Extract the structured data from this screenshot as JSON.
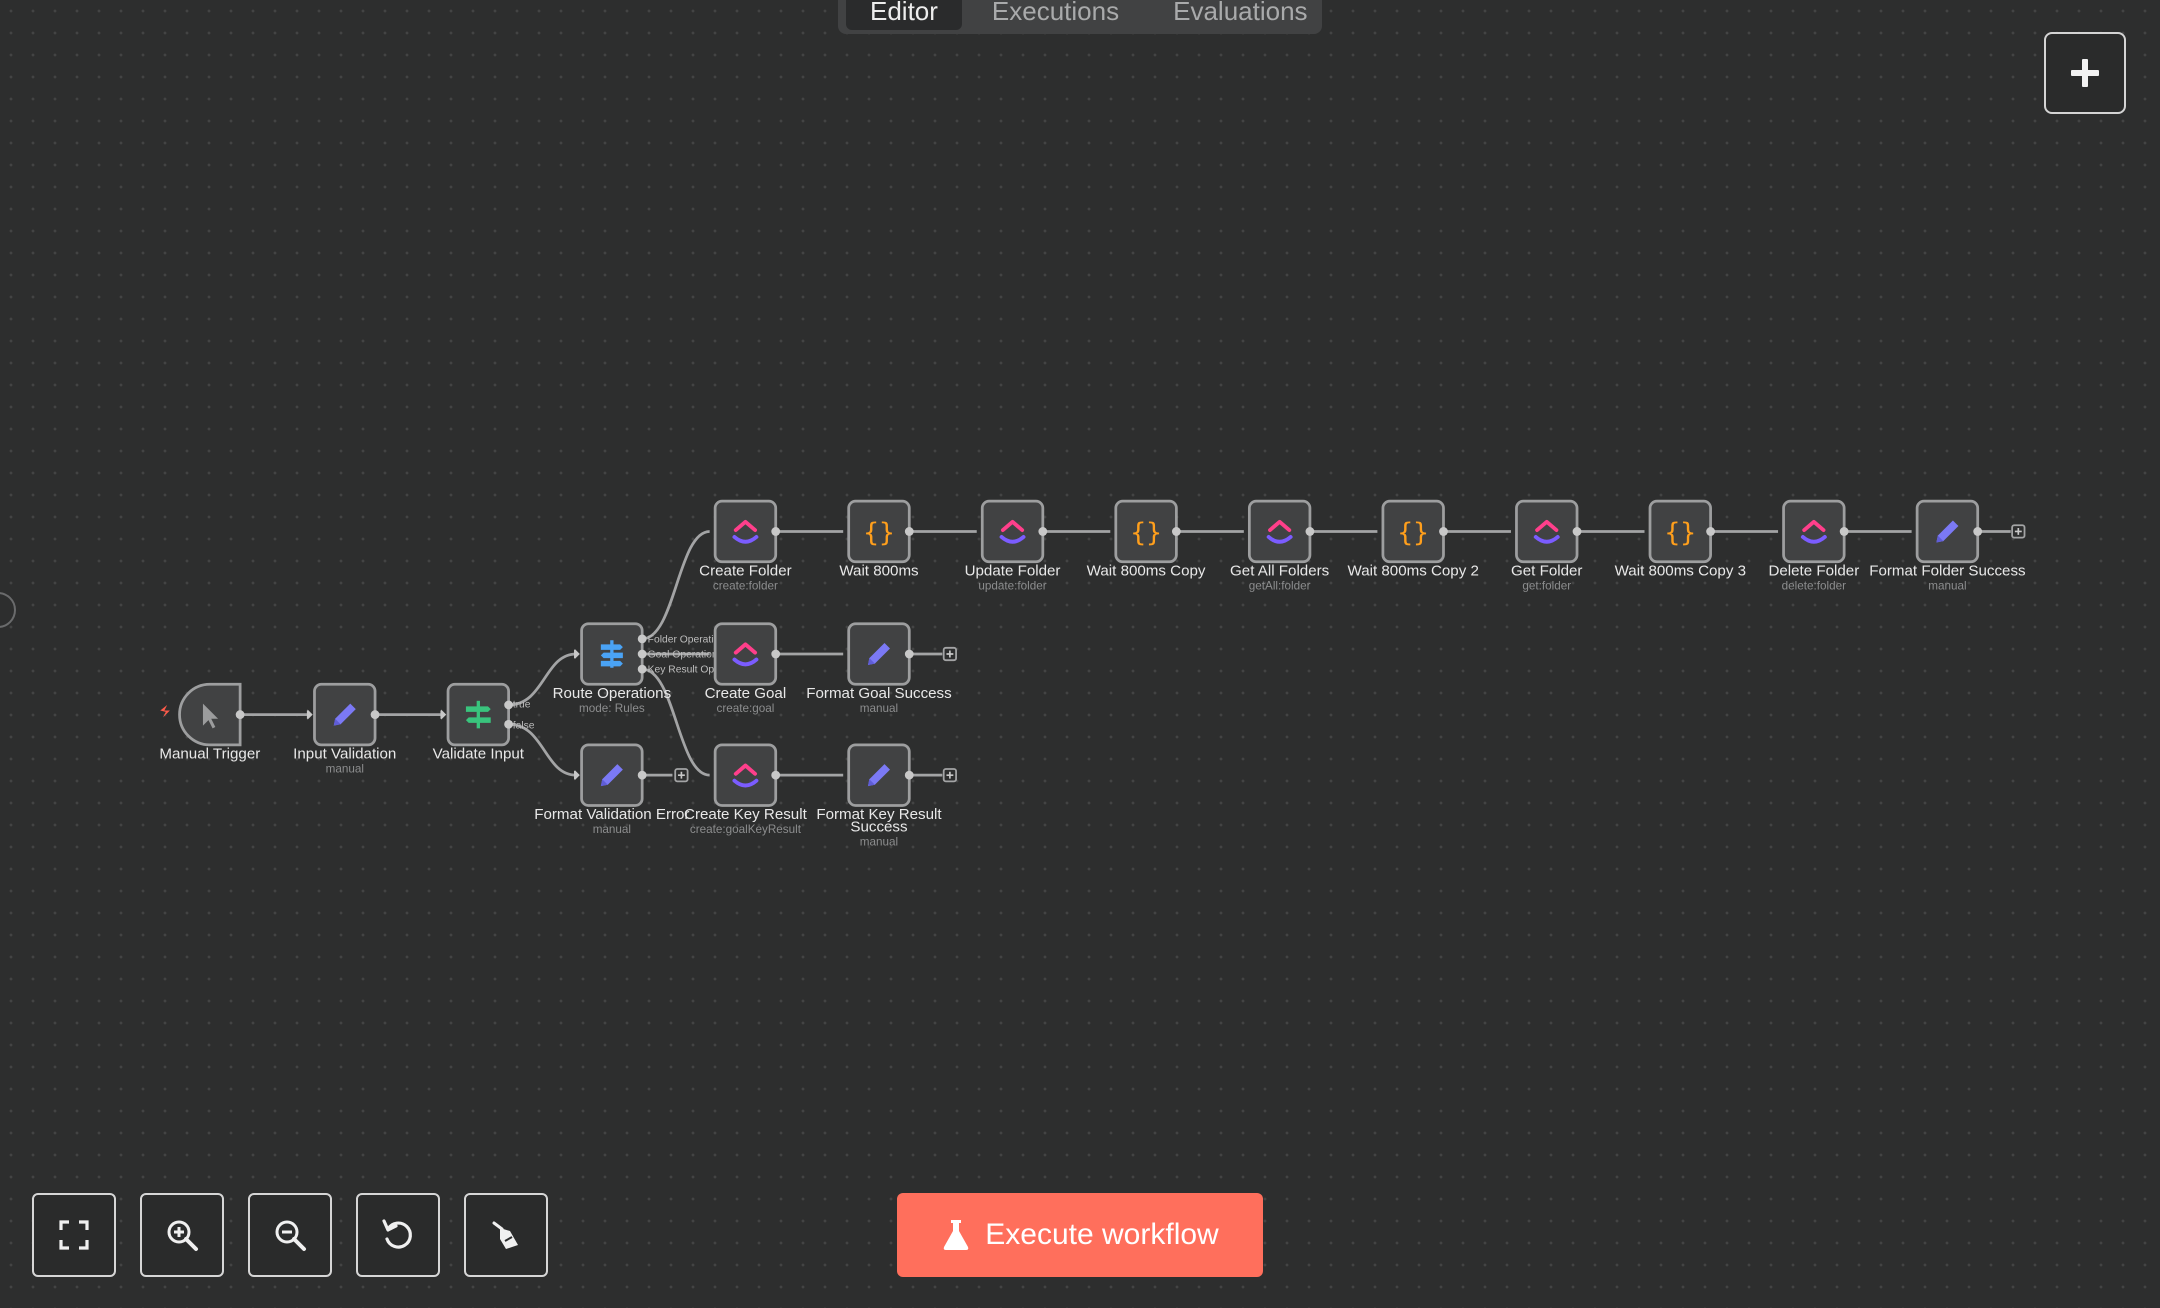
{
  "tabs": [
    {
      "label": "Editor",
      "active": true
    },
    {
      "label": "Executions",
      "active": false
    },
    {
      "label": "Evaluations",
      "active": false
    }
  ],
  "execute_button": {
    "label": "Execute workflow"
  },
  "colors": {
    "canvas": "#2d2e2e",
    "accent": "#ff6f5c",
    "clickup_icon": "multicolor",
    "code_icon": "#ff9f1c",
    "edit_icon": "#7b79f5",
    "filter_icon": "#39c47d",
    "switch_icon": "#4aa3f5",
    "trigger_mark": "#ff5b4a"
  },
  "nodes": [
    {
      "id": "manual-trigger",
      "label": "Manual Trigger",
      "sublabel": "",
      "icon": "cursor-icon"
    },
    {
      "id": "input-validation",
      "label": "Input Validation",
      "sublabel": "manual",
      "icon": "pencil-icon"
    },
    {
      "id": "validate-input",
      "label": "Validate Input",
      "sublabel": "",
      "icon": "filter-icon"
    },
    {
      "id": "route-operations",
      "label": "Route Operations",
      "sublabel": "mode: Rules",
      "icon": "switch-icon"
    },
    {
      "id": "format-validation-error",
      "label": "Format Validation Error",
      "sublabel": "manual",
      "icon": "pencil-icon"
    },
    {
      "id": "create-folder",
      "label": "Create Folder",
      "sublabel": "create:folder",
      "icon": "clickup-icon"
    },
    {
      "id": "wait-800ms",
      "label": "Wait 800ms",
      "sublabel": "",
      "icon": "code-braces-icon"
    },
    {
      "id": "update-folder",
      "label": "Update Folder",
      "sublabel": "update:folder",
      "icon": "clickup-icon"
    },
    {
      "id": "wait-800ms-copy",
      "label": "Wait 800ms Copy",
      "sublabel": "",
      "icon": "code-braces-icon"
    },
    {
      "id": "get-all-folders",
      "label": "Get All Folders",
      "sublabel": "getAll:folder",
      "icon": "clickup-icon"
    },
    {
      "id": "wait-800ms-copy-2",
      "label": "Wait 800ms Copy 2",
      "sublabel": "",
      "icon": "code-braces-icon"
    },
    {
      "id": "get-folder",
      "label": "Get Folder",
      "sublabel": "get:folder",
      "icon": "clickup-icon"
    },
    {
      "id": "wait-800ms-copy-3",
      "label": "Wait 800ms Copy 3",
      "sublabel": "",
      "icon": "code-braces-icon"
    },
    {
      "id": "delete-folder",
      "label": "Delete Folder",
      "sublabel": "delete:folder",
      "icon": "clickup-icon"
    },
    {
      "id": "format-folder-success",
      "label": "Format Folder Success",
      "sublabel": "manual",
      "icon": "pencil-icon"
    },
    {
      "id": "create-goal",
      "label": "Create Goal",
      "sublabel": "create:goal",
      "icon": "clickup-icon"
    },
    {
      "id": "format-goal-success",
      "label": "Format Goal Success",
      "sublabel": "manual",
      "icon": "pencil-icon"
    },
    {
      "id": "create-key-result",
      "label": "Create Key Result",
      "sublabel": "create:goalKeyResult",
      "icon": "clickup-icon"
    },
    {
      "id": "format-key-result-success",
      "label": "Format Key Result Success",
      "sublabel": "manual",
      "icon": "pencil-icon"
    }
  ],
  "port_labels": {
    "validate_true": "true",
    "validate_false": "false",
    "route_0": "Folder Operati...",
    "route_1": "Goal Operations",
    "route_2": "Key Result Op..."
  },
  "controls": [
    {
      "name": "fit-view-button",
      "icon": "fit-view-icon"
    },
    {
      "name": "zoom-in-button",
      "icon": "zoom-in-icon"
    },
    {
      "name": "zoom-out-button",
      "icon": "zoom-out-icon"
    },
    {
      "name": "reset-zoom-button",
      "icon": "undo-icon"
    },
    {
      "name": "tidy-up-button",
      "icon": "broom-icon"
    }
  ]
}
